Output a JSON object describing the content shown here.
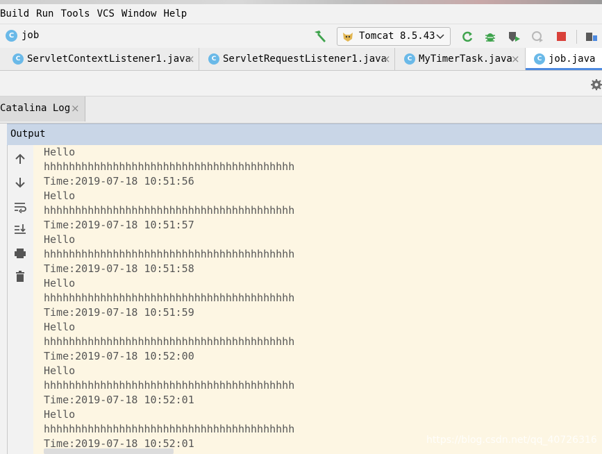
{
  "menu": [
    "Build",
    "Run",
    "Tools",
    "VCS",
    "Window",
    "Help"
  ],
  "breadcrumb": {
    "icon": "C",
    "label": "job"
  },
  "toolbar": {
    "run_config": "Tomcat 8.5.43"
  },
  "tabs": [
    {
      "icon": "C",
      "label": "ServletContextListener1.java",
      "close": "×"
    },
    {
      "icon": "C",
      "label": "ServletRequestListener1.java",
      "close": "×"
    },
    {
      "icon": "C",
      "label": "MyTimerTask.java",
      "close": "×"
    },
    {
      "icon": "C",
      "label": "job.java"
    }
  ],
  "log_tab": {
    "label": "Catalina Log",
    "close": "×"
  },
  "output_title": "Output",
  "console_lines": [
    "Hello",
    "hhhhhhhhhhhhhhhhhhhhhhhhhhhhhhhhhhhhhhhh",
    "Time:2019-07-18 10:51:56",
    "Hello",
    "hhhhhhhhhhhhhhhhhhhhhhhhhhhhhhhhhhhhhhhh",
    "Time:2019-07-18 10:51:57",
    "Hello",
    "hhhhhhhhhhhhhhhhhhhhhhhhhhhhhhhhhhhhhhhh",
    "Time:2019-07-18 10:51:58",
    "Hello",
    "hhhhhhhhhhhhhhhhhhhhhhhhhhhhhhhhhhhhhhhh",
    "Time:2019-07-18 10:51:59",
    "Hello",
    "hhhhhhhhhhhhhhhhhhhhhhhhhhhhhhhhhhhhhhhh",
    "Time:2019-07-18 10:52:00",
    "Hello",
    "hhhhhhhhhhhhhhhhhhhhhhhhhhhhhhhhhhhhhhhh",
    "Time:2019-07-18 10:52:01",
    "Hello",
    "hhhhhhhhhhhhhhhhhhhhhhhhhhhhhhhhhhhhhhhh",
    "Time:2019-07-18 10:52:01"
  ],
  "watermark": "https://blog.csdn.net/qq_40726316",
  "colors": {
    "console_bg": "#fdf6e3",
    "output_header": "#c9d6e7",
    "tab_accent": "#4d8ae0",
    "run_green": "#3fa34d",
    "stop_red": "#d9413a"
  }
}
